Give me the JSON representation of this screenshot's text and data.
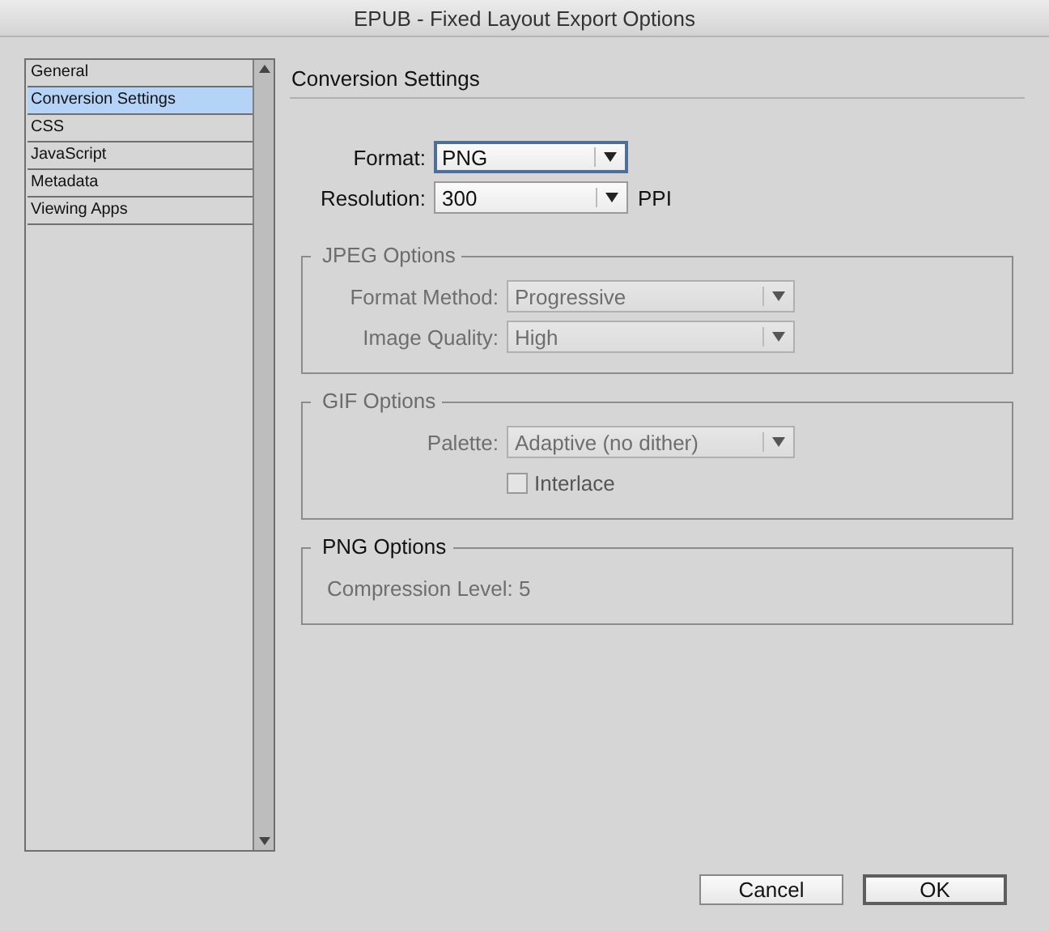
{
  "window": {
    "title": "EPUB - Fixed Layout Export Options"
  },
  "sidebar": {
    "items": [
      {
        "label": "General",
        "selected": false
      },
      {
        "label": "Conversion Settings",
        "selected": true
      },
      {
        "label": "CSS",
        "selected": false
      },
      {
        "label": "JavaScript",
        "selected": false
      },
      {
        "label": "Metadata",
        "selected": false
      },
      {
        "label": "Viewing Apps",
        "selected": false
      }
    ]
  },
  "section_title": "Conversion Settings",
  "fields": [
    {
      "label": "Format:",
      "value": "PNG",
      "focused": true
    },
    {
      "label": "Resolution:",
      "value": "300",
      "unit": "PPI",
      "focused": false
    }
  ],
  "groups": [
    {
      "title": "JPEG Options",
      "disabled": true,
      "rows": [
        {
          "kind": "select",
          "label": "Format Method:",
          "value": "Progressive",
          "disabled": true
        },
        {
          "kind": "select",
          "label": "Image Quality:",
          "value": "High",
          "disabled": true
        }
      ]
    },
    {
      "title": "GIF Options",
      "disabled": true,
      "rows": [
        {
          "kind": "select",
          "label": "Palette:",
          "value": "Adaptive (no dither)",
          "disabled": true
        },
        {
          "kind": "checkbox",
          "label": "Interlace",
          "checked": false,
          "disabled": true
        }
      ]
    },
    {
      "title": "PNG Options",
      "disabled": false,
      "rows": [
        {
          "kind": "text",
          "label": "Compression Level:",
          "value": "5",
          "disabled": true
        }
      ]
    }
  ],
  "buttons": [
    {
      "label": "Cancel",
      "default": false
    },
    {
      "label": "OK",
      "default": true
    }
  ]
}
